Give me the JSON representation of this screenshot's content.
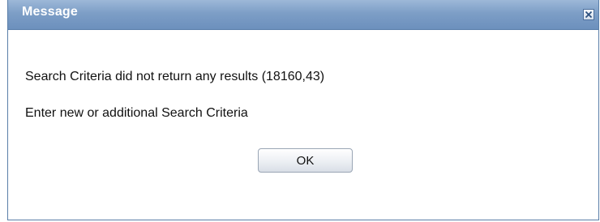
{
  "dialog": {
    "title": "Message",
    "close_icon": "close-icon",
    "message_line_1": "Search Criteria did not return any results (18160,43)",
    "message_line_2": "Enter new or additional Search Criteria",
    "ok_label": "OK"
  },
  "colors": {
    "titlebar": "#7d9ec6",
    "title_text": "#ffffff",
    "border": "#5a7ea8"
  }
}
